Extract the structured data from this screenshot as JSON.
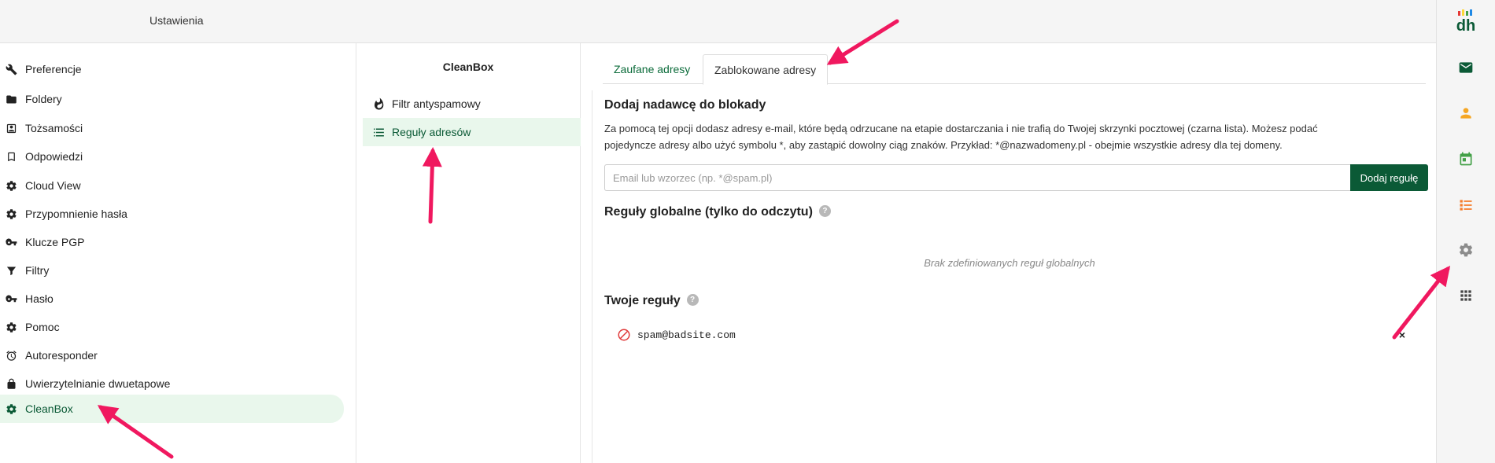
{
  "header": {
    "title": "Ustawienia"
  },
  "left_nav": {
    "items": [
      {
        "label": "Preferencje",
        "icon": "wrench-icon"
      },
      {
        "label": "Foldery",
        "icon": "folder-icon"
      },
      {
        "label": "Tożsamości",
        "icon": "id-card-icon"
      },
      {
        "label": "Odpowiedzi",
        "icon": "bookmark-icon"
      },
      {
        "label": "Cloud View",
        "icon": "gear-icon"
      },
      {
        "label": "Przypomnienie hasła",
        "icon": "gear-icon"
      },
      {
        "label": "Klucze PGP",
        "icon": "key-icon"
      },
      {
        "label": "Filtry",
        "icon": "filter-icon"
      },
      {
        "label": "Hasło",
        "icon": "key-icon"
      },
      {
        "label": "Pomoc",
        "icon": "gear-icon"
      },
      {
        "label": "Autoresponder",
        "icon": "alarm-clock-icon"
      },
      {
        "label": "Uwierzytelnianie dwuetapowe",
        "icon": "lock-icon"
      },
      {
        "label": "CleanBox",
        "icon": "gear-icon",
        "active": true
      }
    ]
  },
  "mid": {
    "heading": "CleanBox",
    "items": [
      {
        "label": "Filtr antyspamowy",
        "icon": "flame-icon"
      },
      {
        "label": "Reguły adresów",
        "icon": "list-icon",
        "active": true
      }
    ]
  },
  "main": {
    "tabs": [
      {
        "label": "Zaufane adresy"
      },
      {
        "label": "Zablokowane adresy",
        "active": true
      }
    ],
    "add_section": {
      "title": "Dodaj nadawcę do blokady",
      "desc_line1": "Za pomocą tej opcji dodasz adresy e-mail, które będą odrzucane na etapie dostarczania i nie trafią do Twojej skrzynki pocztowej (czarna lista). Możesz podać",
      "desc_line2": "pojedyncze adresy albo użyć symbolu *, aby zastąpić dowolny ciąg znaków. Przykład: *@nazwadomeny.pl - obejmie wszystkie adresy dla tej domeny.",
      "input_value": "",
      "input_placeholder": "Email lub wzorzec (np. *@spam.pl)",
      "button_label": "Dodaj regułę"
    },
    "global_rules": {
      "title": "Reguły globalne (tylko do odczytu)",
      "help": "?",
      "empty_text": "Brak zdefiniowanych reguł globalnych"
    },
    "user_rules": {
      "title": "Twoje reguły",
      "help": "?",
      "items": [
        {
          "address": "spam@badsite.com",
          "delete": "×"
        }
      ]
    }
  },
  "rail": {
    "items": [
      "mail-icon",
      "contacts-icon",
      "calendar-icon",
      "tasks-icon",
      "settings-icon",
      "apps-grid-icon"
    ]
  },
  "colors": {
    "accent": "#0b5a36",
    "active_bg": "#e9f7ec",
    "annotation_arrow": "#f0185f"
  }
}
